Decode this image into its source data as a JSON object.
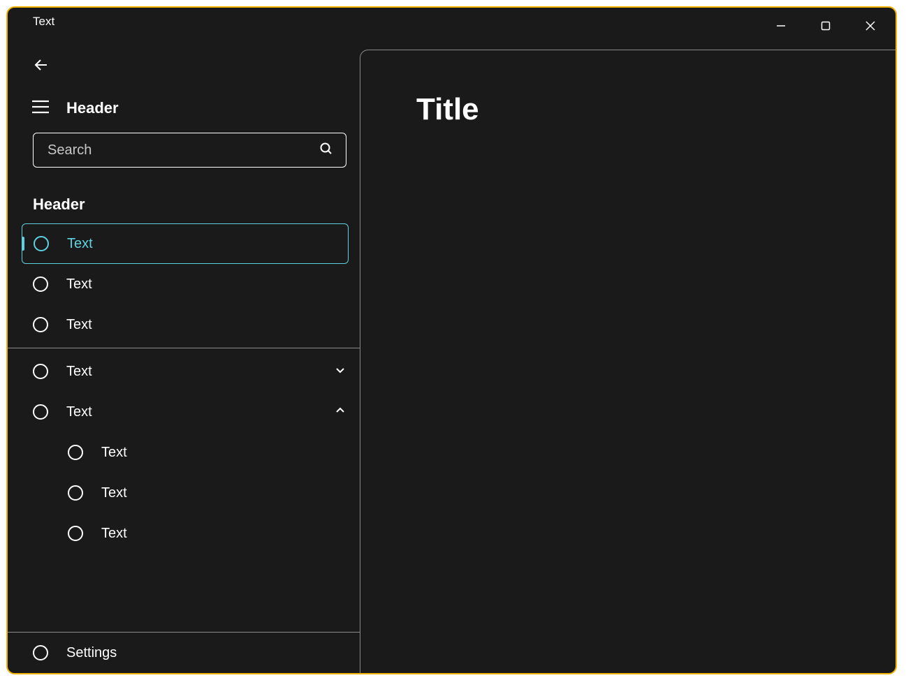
{
  "window": {
    "title": "Text"
  },
  "sidebar": {
    "header_label": "Header",
    "search": {
      "placeholder": "Search"
    },
    "section_header": "Header",
    "group1": [
      {
        "label": "Text",
        "selected": true
      },
      {
        "label": "Text",
        "selected": false
      },
      {
        "label": "Text",
        "selected": false
      }
    ],
    "group2": [
      {
        "label": "Text",
        "expand": "down"
      },
      {
        "label": "Text",
        "expand": "up",
        "children": [
          {
            "label": "Text"
          },
          {
            "label": "Text"
          },
          {
            "label": "Text"
          }
        ]
      }
    ],
    "footer": {
      "label": "Settings"
    }
  },
  "main": {
    "title": "Title"
  }
}
